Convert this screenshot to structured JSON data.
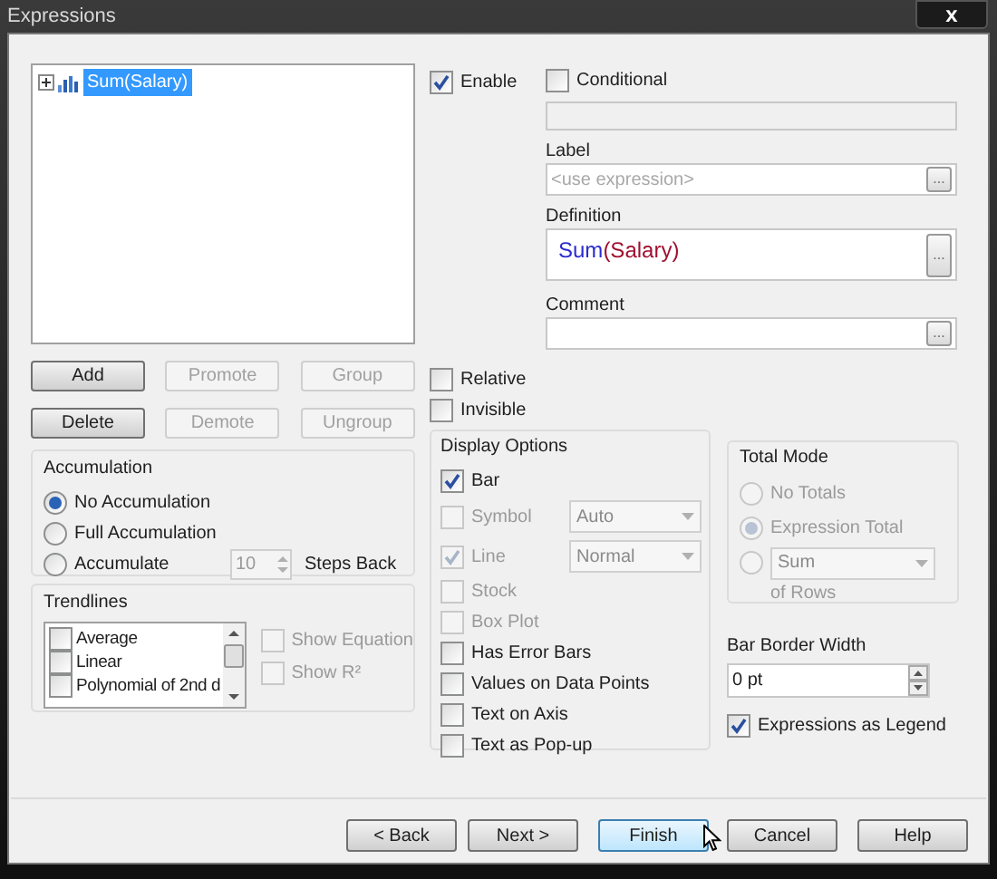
{
  "window": {
    "title": "Expressions",
    "close": "x"
  },
  "tree": {
    "items": [
      {
        "label": "Sum(Salary)",
        "selected": true,
        "expanded": false
      }
    ]
  },
  "list_buttons": [
    {
      "label": "Add",
      "disabled": false
    },
    {
      "label": "Promote",
      "disabled": true
    },
    {
      "label": "Group",
      "disabled": true
    },
    {
      "label": "Delete",
      "disabled": false
    },
    {
      "label": "Demote",
      "disabled": true
    },
    {
      "label": "Ungroup",
      "disabled": true
    }
  ],
  "enable": {
    "label": "Enable",
    "checked": true
  },
  "conditional": {
    "label": "Conditional",
    "checked": false
  },
  "label_field": {
    "caption": "Label",
    "placeholder": "<use expression>",
    "browse": "..."
  },
  "definition": {
    "caption": "Definition",
    "tokens": [
      {
        "text": "Sum",
        "kind": "function"
      },
      {
        "text": "(Salary)",
        "kind": "field"
      }
    ],
    "browse": "..."
  },
  "comment": {
    "caption": "Comment",
    "browse": "..."
  },
  "flags": [
    {
      "label": "Relative",
      "checked": false
    },
    {
      "label": "Invisible",
      "checked": false
    }
  ],
  "accumulation": {
    "title": "Accumulation",
    "options": [
      {
        "label": "No Accumulation",
        "selected": true
      },
      {
        "label": "Full Accumulation",
        "selected": false
      },
      {
        "label": "Accumulate",
        "selected": false
      }
    ],
    "steps": "10",
    "steps_label": "Steps Back"
  },
  "trendlines": {
    "title": "Trendlines",
    "items": [
      {
        "label": "Average",
        "checked": false
      },
      {
        "label": "Linear",
        "checked": false
      },
      {
        "label": "Polynomial of 2nd d",
        "checked": false
      }
    ],
    "options": [
      {
        "label": "Show Equation",
        "checked": false,
        "disabled": true
      },
      {
        "label": "Show R²",
        "checked": false,
        "disabled": true
      }
    ]
  },
  "display_options": {
    "title": "Display Options",
    "items": [
      {
        "kind": "checkbox",
        "label": "Bar",
        "checked": true,
        "disabled": false
      },
      {
        "kind": "dropdown",
        "label": "Symbol",
        "checked": false,
        "disabled": true,
        "value": "Auto"
      },
      {
        "kind": "dropdown",
        "label": "Line",
        "checked": true,
        "disabled": true,
        "value": "Normal"
      },
      {
        "kind": "checkbox",
        "label": "Stock",
        "checked": false,
        "disabled": true
      },
      {
        "kind": "checkbox",
        "label": "Box Plot",
        "checked": false,
        "disabled": true
      },
      {
        "kind": "checkbox",
        "label": "Has Error Bars",
        "checked": false,
        "disabled": false
      },
      {
        "kind": "checkbox",
        "label": "Values on Data Points",
        "checked": false,
        "disabled": false
      },
      {
        "kind": "checkbox",
        "label": "Text on Axis",
        "checked": false,
        "disabled": false
      },
      {
        "kind": "checkbox",
        "label": "Text as Pop-up",
        "checked": false,
        "disabled": false
      }
    ]
  },
  "total_mode": {
    "title": "Total Mode",
    "options": [
      {
        "kind": "radio",
        "label": "No Totals",
        "selected": false
      },
      {
        "kind": "radio",
        "label": "Expression Total",
        "selected": true
      },
      {
        "kind": "dropdown",
        "value": "Sum",
        "selected": false
      }
    ],
    "suffix": "of Rows"
  },
  "bar_border_width": {
    "caption": "Bar Border Width",
    "value": "0 pt"
  },
  "legend": {
    "label": "Expressions as Legend",
    "checked": true
  },
  "footer_buttons": [
    {
      "label": "< Back",
      "focused": false
    },
    {
      "label": "Next >",
      "focused": false
    },
    {
      "label": "Finish",
      "focused": true
    },
    {
      "label": "Cancel",
      "focused": false
    },
    {
      "label": "Help",
      "focused": false
    }
  ]
}
